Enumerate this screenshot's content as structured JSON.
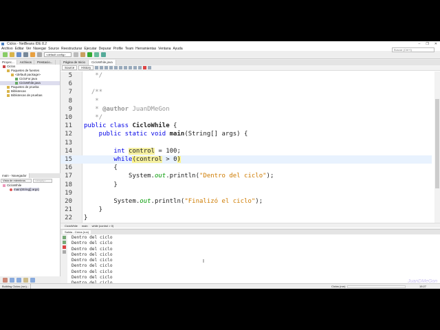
{
  "window": {
    "title": "Ciclos - NetBeans IDE 8.2",
    "controls": [
      "–",
      "❐",
      "✕"
    ]
  },
  "menu": [
    "Archivo",
    "Editar",
    "Ver",
    "Navegar",
    "Source",
    "Reestructurar",
    "Ejecutar",
    "Depurar",
    "Profile",
    "Team",
    "Herramientas",
    "Ventana",
    "Ayuda"
  ],
  "toolbar": {
    "config": "<default config>",
    "search_placeholder": "Buscar (Ctrl+I)"
  },
  "projects": {
    "tabs": [
      "Proyec...",
      "Archivos",
      "Prestacio..."
    ],
    "tree": [
      {
        "label": "Ciclos",
        "indent": 1
      },
      {
        "label": "Paquetes de fuentes",
        "indent": 2
      },
      {
        "label": "<default package>",
        "indent": 3
      },
      {
        "label": "CicloFor.java",
        "indent": 4
      },
      {
        "label": "CicloWhile.java",
        "indent": 4
      },
      {
        "label": "Paquetes de prueba",
        "indent": 2
      },
      {
        "label": "Bibliotecas",
        "indent": 2
      },
      {
        "label": "Bibliotecas de pruebas",
        "indent": 2
      }
    ]
  },
  "navigator": {
    "title": "main - Navegador",
    "view": "Vista de miembros",
    "filter": "<empty>",
    "tree": [
      "CicloWhile",
      "main(String[] args)"
    ]
  },
  "editor": {
    "tabs": [
      "Página de Inicio",
      "CicloWhile.java"
    ],
    "source_btn": "Source",
    "history_btn": "History",
    "lines": [
      {
        "n": "5",
        "seg": [
          [
            "   */",
            "cm"
          ]
        ]
      },
      {
        "n": "6",
        "seg": []
      },
      {
        "n": "7",
        "seg": [
          [
            "  /**",
            "cm"
          ]
        ]
      },
      {
        "n": "8",
        "seg": [
          [
            "   *",
            "cm"
          ]
        ]
      },
      {
        "n": "9",
        "seg": [
          [
            "   * ",
            "cm"
          ],
          [
            "@author",
            "cm b"
          ],
          [
            " JuanDMeGon",
            "cm"
          ]
        ]
      },
      {
        "n": "10",
        "seg": [
          [
            "   */",
            "cm"
          ]
        ]
      },
      {
        "n": "11",
        "seg": [
          [
            "public class ",
            "k"
          ],
          [
            "CicloWhile",
            "b"
          ],
          [
            " {",
            ""
          ]
        ]
      },
      {
        "n": "12",
        "seg": [
          [
            "    public static void ",
            "k"
          ],
          [
            "main",
            "b"
          ],
          [
            "(String[] args) {",
            ""
          ]
        ]
      },
      {
        "n": "13",
        "seg": []
      },
      {
        "n": "14",
        "seg": [
          [
            "        int ",
            "k"
          ],
          [
            "control",
            "h"
          ],
          [
            " = 100;",
            ""
          ]
        ]
      },
      {
        "n": "15",
        "cur": true,
        "seg": [
          [
            "        while",
            "k"
          ],
          [
            "(",
            "ht"
          ],
          [
            "control",
            "h"
          ],
          [
            " > 0",
            ""
          ],
          [
            ")",
            "ht"
          ]
        ]
      },
      {
        "n": "16",
        "seg": [
          [
            "        {",
            ""
          ]
        ]
      },
      {
        "n": "17",
        "seg": [
          [
            "            System.",
            ""
          ],
          [
            "out",
            "o"
          ],
          [
            ".println(",
            ""
          ],
          [
            "\"Dentro del ciclo\"",
            "s"
          ],
          [
            ");",
            ""
          ]
        ]
      },
      {
        "n": "18",
        "seg": [
          [
            "        }",
            ""
          ]
        ]
      },
      {
        "n": "19",
        "seg": []
      },
      {
        "n": "20",
        "seg": [
          [
            "        System.",
            ""
          ],
          [
            "out",
            "o"
          ],
          [
            ".println(",
            ""
          ],
          [
            "\"Finalizó el ciclo\"",
            "s"
          ],
          [
            ");",
            ""
          ]
        ]
      },
      {
        "n": "21",
        "seg": [
          [
            "    }",
            ""
          ]
        ]
      },
      {
        "n": "22",
        "seg": [
          [
            "}",
            ""
          ]
        ]
      }
    ]
  },
  "breadcrumb": [
    "CicloWhile",
    "main",
    "while (control > 0)"
  ],
  "output": {
    "tab": "Salida - Ciclos (run)",
    "lines": [
      "Dentro del ciclo",
      "Dentro del ciclo",
      "Dentro del ciclo",
      "Dentro del ciclo",
      "Dentro del ciclo",
      "Dentro del ciclo",
      "Dentro del ciclo",
      "Dentro del ciclo",
      "Dentro del ciclo"
    ]
  },
  "status": {
    "task": "Building Ciclos (run)...",
    "run": "Ciclos (run)",
    "position": "15:27",
    "watermark": "JuanDMeGon"
  }
}
